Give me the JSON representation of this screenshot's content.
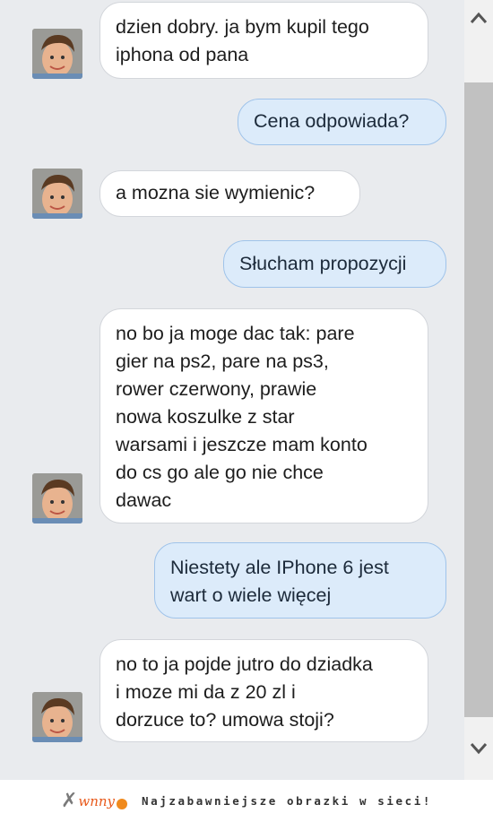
{
  "messages": [
    {
      "from": "them",
      "text_lines": [
        "dzien dobry. ja bym kupil tego",
        "iphona od pana"
      ]
    },
    {
      "from": "me",
      "text_lines": [
        "Cena odpowiada?"
      ]
    },
    {
      "from": "them",
      "text_lines": [
        "a mozna sie wymienic?"
      ]
    },
    {
      "from": "me",
      "text_lines": [
        "Słucham propozycji"
      ]
    },
    {
      "from": "them",
      "text_lines": [
        "no bo ja moge dac tak: pare",
        "gier na ps2, pare na ps3,",
        "rower czerwony, prawie",
        "nowa koszulke z star",
        "warsami i jeszcze mam konto",
        "do cs go ale go nie chce",
        "dawac"
      ]
    },
    {
      "from": "me",
      "text_lines": [
        "Niestety ale IPhone 6 jest",
        "wart o wiele więcej"
      ]
    },
    {
      "from": "them",
      "text_lines": [
        "no to ja pojde jutro do dziadka",
        "i moze mi da z 20 zl i",
        "dorzuce to? umowa stoji?"
      ]
    }
  ],
  "scrollbar": {
    "up_icon": "chevron-up-icon",
    "down_icon": "chevron-down-icon"
  },
  "footer": {
    "logo_text": "wnny",
    "tagline": "Najzabawniejsze obrazki w sieci!"
  },
  "colors": {
    "background": "#e9ebee",
    "incoming_bubble": "#ffffff",
    "outgoing_bubble": "#dcebfa",
    "outgoing_border": "#9fc3ea",
    "logo_accent": "#e85a1c"
  }
}
